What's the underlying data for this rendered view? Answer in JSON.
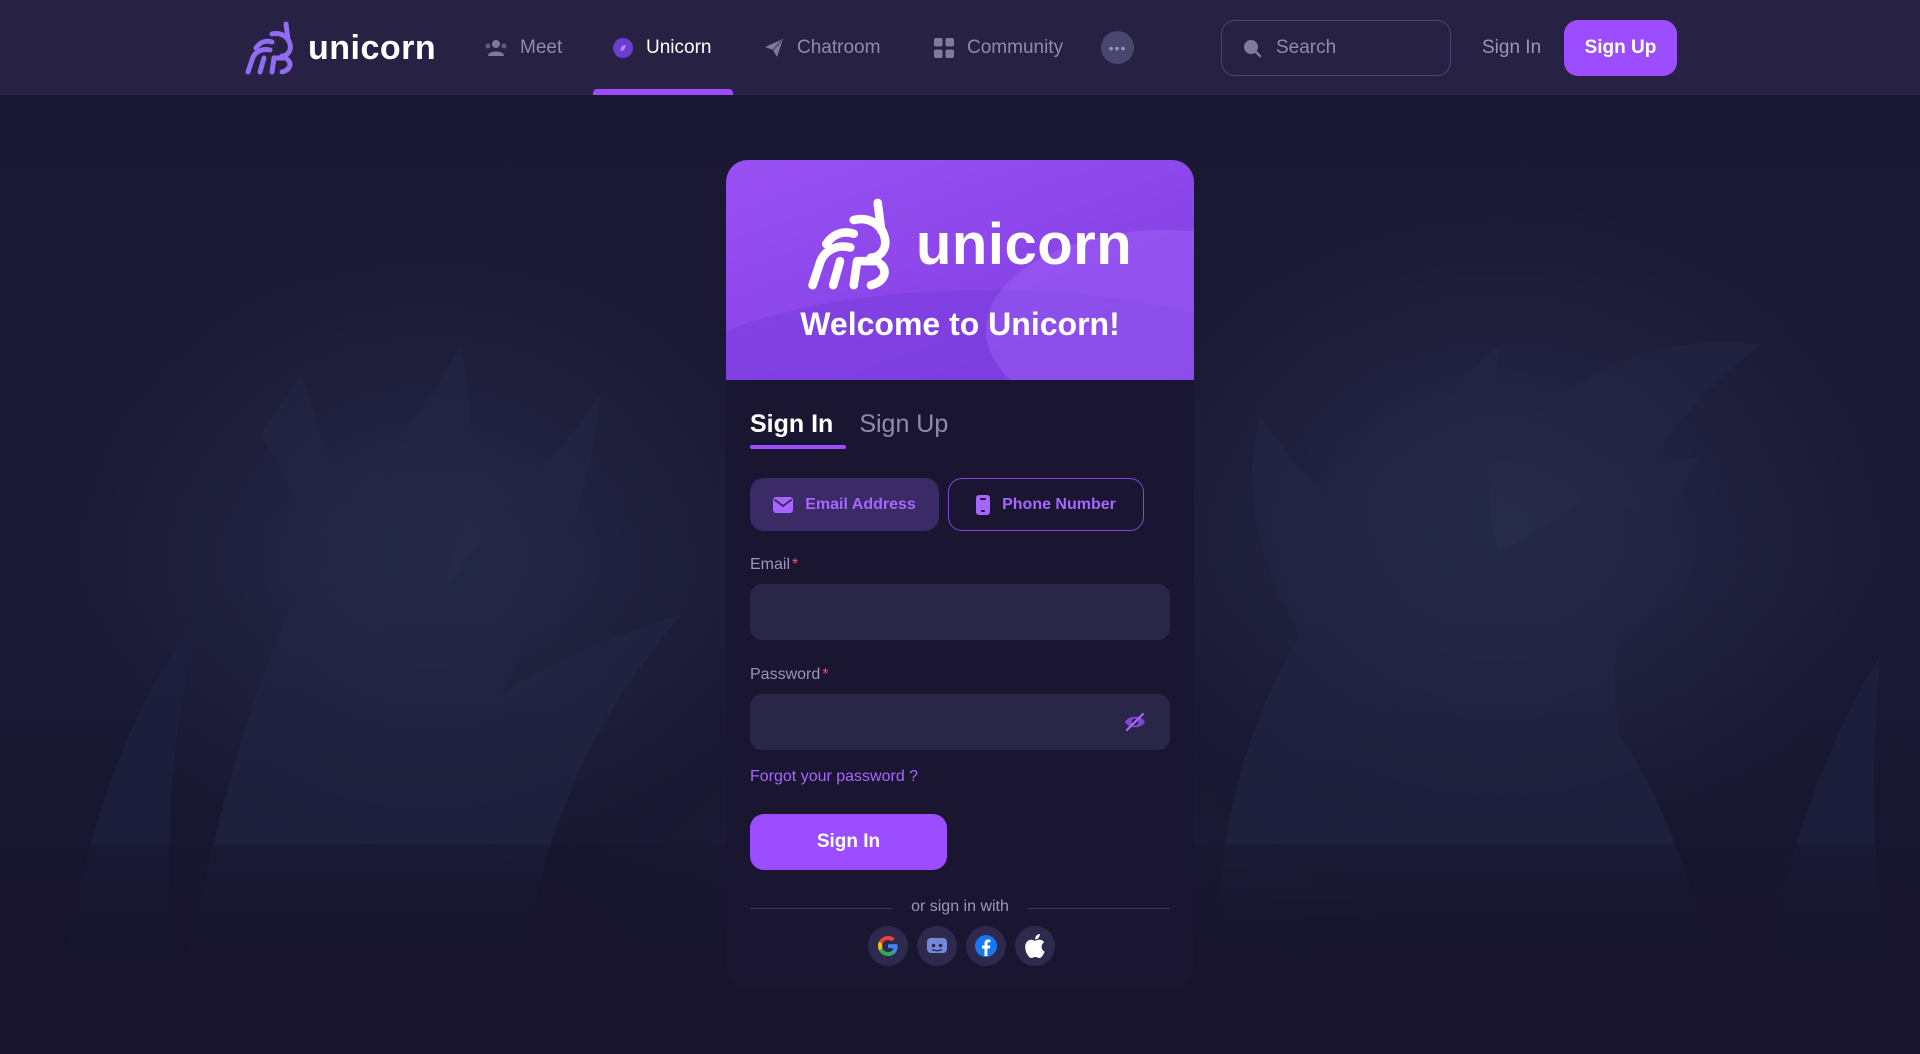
{
  "brand": {
    "name": "unicorn"
  },
  "nav": {
    "items": [
      {
        "label": "Meet",
        "icon": "users-icon",
        "active": false
      },
      {
        "label": "Unicorn",
        "icon": "compass-icon",
        "active": true
      },
      {
        "label": "Chatroom",
        "icon": "paper-plane-icon",
        "active": false
      },
      {
        "label": "Community",
        "icon": "grid-icon",
        "active": false
      }
    ],
    "more_label": "•••",
    "search_placeholder": "Search",
    "signin_label": "Sign In",
    "signup_label": "Sign Up"
  },
  "card": {
    "logo_text": "unicorn",
    "welcome": "Welcome to Unicorn!",
    "tabs": [
      {
        "label": "Sign In",
        "active": true
      },
      {
        "label": "Sign Up",
        "active": false
      }
    ],
    "modes": {
      "email_label": "Email Address",
      "phone_label": "Phone Number"
    },
    "email": {
      "label": "Email",
      "required_mark": "*",
      "value": "",
      "placeholder": ""
    },
    "password": {
      "label": "Password",
      "required_mark": "*",
      "value": "",
      "placeholder": ""
    },
    "forgot_label": "Forgot your password ?",
    "submit_label": "Sign In",
    "divider_text": "or sign in with",
    "socials": [
      "google-icon",
      "discord-icon",
      "facebook-icon",
      "apple-icon"
    ]
  },
  "colors": {
    "accent": "#9b4dff",
    "nav_bg": "#272244",
    "page_bg": "#16132b",
    "required": "#ff4d6d"
  }
}
